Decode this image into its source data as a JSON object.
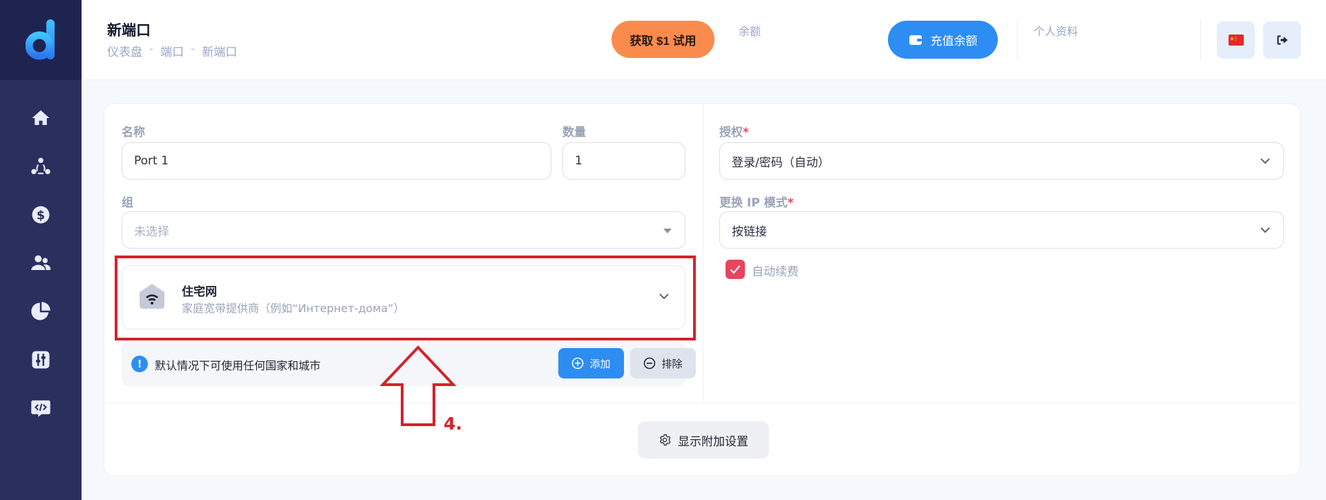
{
  "header": {
    "title": "新端口",
    "breadcrumb": [
      "仪表盘",
      "端口",
      "新端口"
    ],
    "trial_button": "获取 $1 试用",
    "balance_label": "余额",
    "topup_button": "充值余额",
    "profile_label": "个人资料"
  },
  "sidebar": {
    "items": [
      {
        "icon": "home-icon"
      },
      {
        "icon": "network-icon"
      },
      {
        "icon": "dollar-icon"
      },
      {
        "icon": "users-icon"
      },
      {
        "icon": "pie-chart-icon"
      },
      {
        "icon": "sliders-icon"
      },
      {
        "icon": "code-icon"
      }
    ]
  },
  "form": {
    "name_label": "名称",
    "name_value": "Port 1",
    "quantity_label": "数量",
    "quantity_value": "1",
    "group_label": "组",
    "group_placeholder": "未选择",
    "proxy_type": {
      "title": "住宅网",
      "subtitle": "家庭宽带提供商（例如“Интернет-дома”）"
    },
    "info_text": "默认情况下可使用任何国家和城市",
    "add_button": "添加",
    "exclude_button": "排除",
    "auth_label": "授权",
    "auth_value": "登录/密码（自动）",
    "ip_mode_label": "更换 IP 模式",
    "ip_mode_value": "按链接",
    "auto_renew_label": "自动续费",
    "auto_renew_checked": true,
    "more_settings_button": "显示附加设置",
    "required_mark": "*"
  },
  "annotation": {
    "label": "4.",
    "color": "#d4222c"
  },
  "colors": {
    "sidebar": "#2b2f5e",
    "primary": "#2d8df3",
    "trial": "#fb8b4d",
    "checkbox": "#e8455f"
  }
}
